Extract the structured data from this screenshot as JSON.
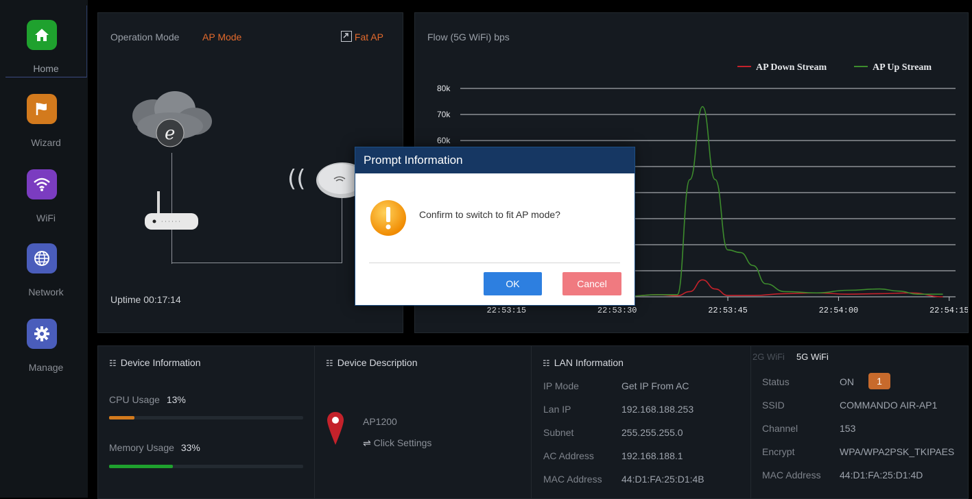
{
  "sidebar": {
    "items": [
      {
        "label": "Home",
        "icon": "home-icon",
        "color": "#1fa12e"
      },
      {
        "label": "Wizard",
        "icon": "flag-icon",
        "color": "#d37a1d"
      },
      {
        "label": "WiFi",
        "icon": "wifi-icon",
        "color": "#7b3cc0"
      },
      {
        "label": "Network",
        "icon": "globe-icon",
        "color": "#4a5dbb"
      },
      {
        "label": "Manage",
        "icon": "gear-icon",
        "color": "#4a5dbb"
      }
    ]
  },
  "topology": {
    "mode_label": "Operation Mode",
    "mode_value": "AP Mode",
    "fat_ap_label": "Fat AP",
    "uptime_label": "Uptime",
    "uptime_value": "00:17:14"
  },
  "flow": {
    "title": "Flow (5G WiFi) bps"
  },
  "chart_data": {
    "type": "line",
    "title": "Flow (5G WiFi) bps",
    "x": [
      "22:53:15",
      "22:53:30",
      "22:53:45",
      "22:54:00",
      "22:54:15"
    ],
    "series": [
      {
        "name": "AP Down Stream",
        "color": "#c4222b",
        "points": [
          [
            0,
            0
          ],
          [
            10,
            0
          ],
          [
            20,
            200
          ],
          [
            25,
            800
          ],
          [
            28,
            400
          ],
          [
            30,
            2000
          ],
          [
            32,
            6500
          ],
          [
            34,
            3000
          ],
          [
            36,
            500
          ],
          [
            40,
            500
          ],
          [
            45,
            1200
          ],
          [
            50,
            1500
          ],
          [
            55,
            1000
          ],
          [
            60,
            1200
          ],
          [
            65,
            1500
          ],
          [
            70,
            0
          ]
        ]
      },
      {
        "name": "AP Up Stream",
        "color": "#3d8c2d",
        "points": [
          [
            0,
            0
          ],
          [
            10,
            0
          ],
          [
            20,
            200
          ],
          [
            25,
            800
          ],
          [
            28,
            800
          ],
          [
            30,
            45000
          ],
          [
            32,
            73000
          ],
          [
            34,
            45000
          ],
          [
            36,
            18000
          ],
          [
            38,
            17000
          ],
          [
            40,
            12000
          ],
          [
            42,
            5000
          ],
          [
            45,
            2000
          ],
          [
            50,
            1500
          ],
          [
            55,
            2500
          ],
          [
            60,
            3000
          ],
          [
            63,
            2200
          ],
          [
            66,
            1000
          ],
          [
            70,
            1000
          ]
        ]
      }
    ],
    "yticks": [
      "80k",
      "70k",
      "60k"
    ],
    "ylim": [
      0,
      80000
    ],
    "xlim": [
      -5,
      72
    ],
    "grid": true,
    "legend": "top-right"
  },
  "device_info": {
    "title": "Device Information",
    "cpu_label": "CPU Usage",
    "cpu_value": "13%",
    "cpu_level": 0.13,
    "cpu_color": "#d37a1d",
    "mem_label": "Memory Usage",
    "mem_value": "33%",
    "mem_level": 0.33,
    "mem_color": "#1fa12e"
  },
  "device_desc": {
    "title": "Device Description",
    "model": "AP1200",
    "settings_label": "Click Settings"
  },
  "lan_info": {
    "title": "LAN Information",
    "rows": [
      {
        "key": "IP Mode",
        "value": "Get IP From AC"
      },
      {
        "key": "Lan IP",
        "value": "192.168.188.253"
      },
      {
        "key": "Subnet",
        "value": "255.255.255.0"
      },
      {
        "key": "AC Address",
        "value": "192.168.188.1"
      },
      {
        "key": "MAC Address",
        "value": "44:D1:FA:25:D1:4B"
      }
    ]
  },
  "wifi_info": {
    "tab_2g": "2G WiFi",
    "tab_5g": "5G WiFi",
    "rows": [
      {
        "key": "Status",
        "value": "ON"
      },
      {
        "key": "SSID",
        "value": "COMMANDO AIR-AP1"
      },
      {
        "key": "Channel",
        "value": "153"
      },
      {
        "key": "Encrypt",
        "value": "WPA/WPA2PSK_TKIPAES"
      },
      {
        "key": "MAC Address",
        "value": "44:D1:FA:25:D1:4D"
      }
    ],
    "status_badge": "1"
  },
  "modal": {
    "title": "Prompt Information",
    "message": "Confirm to switch to fit AP mode?",
    "ok_label": "OK",
    "cancel_label": "Cancel"
  }
}
